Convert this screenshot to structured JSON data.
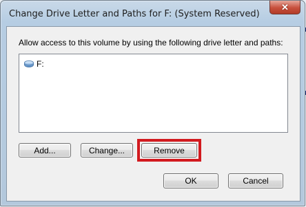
{
  "dialog": {
    "title": "Change Drive Letter and Paths for F: (System Reserved)",
    "close_glyph": "✕",
    "prompt": "Allow access to this volume by using the following drive letter and paths:",
    "list_items": [
      {
        "icon": "drive-icon",
        "label": "F:"
      }
    ],
    "buttons": {
      "add": "Add...",
      "change": "Change...",
      "remove": "Remove",
      "ok": "OK",
      "cancel": "Cancel"
    },
    "highlight_color": "#d21a1f"
  }
}
